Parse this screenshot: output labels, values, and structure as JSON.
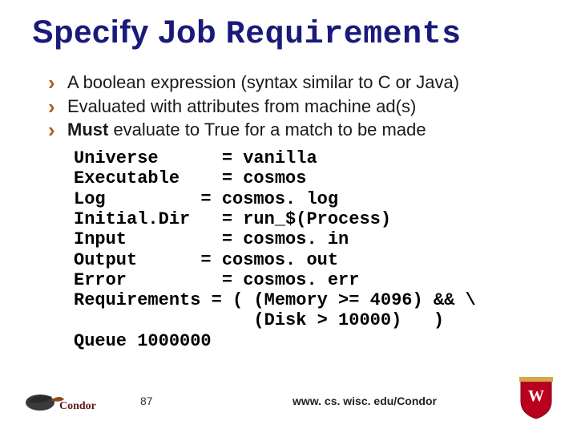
{
  "title": {
    "plain": "Specify Job ",
    "mono": "Requirements"
  },
  "bullets": [
    "A boolean expression (syntax similar to C or Java)",
    "Evaluated with attributes from machine ad(s)",
    "Must evaluate to True for a match to be made"
  ],
  "code": "Universe      = vanilla\nExecutable    = cosmos\nLog         = cosmos. log\nInitial.Dir   = run_$(Process)\nInput         = cosmos. in\nOutput      = cosmos. out\nError         = cosmos. err\nRequirements = ( (Memory >= 4096) && \\\n                 (Disk > 10000)   )\nQueue 1000000",
  "footer": {
    "page": "87",
    "url": "www. cs. wisc. edu/Condor"
  }
}
